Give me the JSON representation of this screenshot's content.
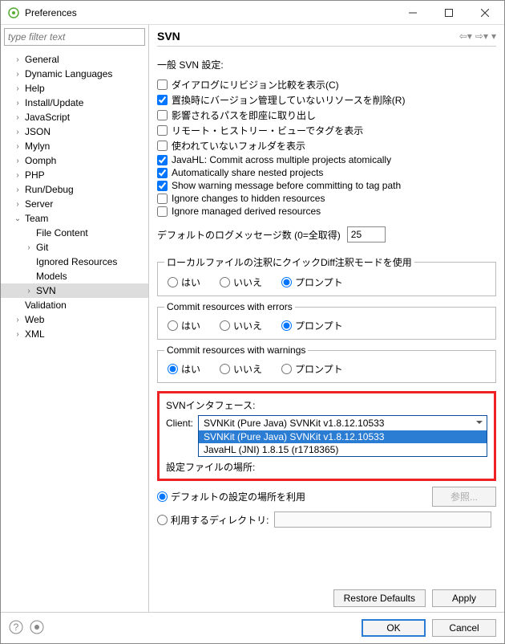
{
  "titlebar": {
    "title": "Preferences"
  },
  "filter": {
    "placeholder": "type filter text"
  },
  "tree": {
    "items": [
      {
        "label": "General",
        "indent": 1,
        "twisty": ">"
      },
      {
        "label": "Dynamic Languages",
        "indent": 1,
        "twisty": ">"
      },
      {
        "label": "Help",
        "indent": 1,
        "twisty": ">"
      },
      {
        "label": "Install/Update",
        "indent": 1,
        "twisty": ">"
      },
      {
        "label": "JavaScript",
        "indent": 1,
        "twisty": ">"
      },
      {
        "label": "JSON",
        "indent": 1,
        "twisty": ">"
      },
      {
        "label": "Mylyn",
        "indent": 1,
        "twisty": ">"
      },
      {
        "label": "Oomph",
        "indent": 1,
        "twisty": ">"
      },
      {
        "label": "PHP",
        "indent": 1,
        "twisty": ">"
      },
      {
        "label": "Run/Debug",
        "indent": 1,
        "twisty": ">"
      },
      {
        "label": "Server",
        "indent": 1,
        "twisty": ">"
      },
      {
        "label": "Team",
        "indent": 1,
        "twisty": "v"
      },
      {
        "label": "File Content",
        "indent": 2,
        "twisty": ""
      },
      {
        "label": "Git",
        "indent": 2,
        "twisty": ">"
      },
      {
        "label": "Ignored Resources",
        "indent": 2,
        "twisty": ""
      },
      {
        "label": "Models",
        "indent": 2,
        "twisty": ""
      },
      {
        "label": "SVN",
        "indent": 2,
        "twisty": ">",
        "selected": true
      },
      {
        "label": "Validation",
        "indent": 1,
        "twisty": ""
      },
      {
        "label": "Web",
        "indent": 1,
        "twisty": ">"
      },
      {
        "label": "XML",
        "indent": 1,
        "twisty": ">"
      }
    ]
  },
  "page": {
    "title": "SVN",
    "generalHeading": "一般 SVN 設定:",
    "checks": [
      {
        "label": "ダイアログにリビジョン比較を表示(C)",
        "checked": false
      },
      {
        "label": "置換時にバージョン管理していないリソースを削除(R)",
        "checked": true
      },
      {
        "label": "影響されるパスを即座に取り出し",
        "checked": false
      },
      {
        "label": "リモート・ヒストリー・ビューでタグを表示",
        "checked": false
      },
      {
        "label": "使われていないフォルダを表示",
        "checked": false
      },
      {
        "label": "JavaHL: Commit across multiple projects atomically",
        "checked": true
      },
      {
        "label": "Automatically share nested projects",
        "checked": true
      },
      {
        "label": "Show warning message before committing to tag path",
        "checked": true
      },
      {
        "label": "Ignore changes to hidden resources",
        "checked": false
      },
      {
        "label": "Ignore managed derived resources",
        "checked": false
      }
    ],
    "logCountLabel": "デフォルトのログメッセージ数 (0=全取得)",
    "logCountValue": "25",
    "groups": [
      {
        "legend": "ローカルファイルの注釈にクイックDiff注釈モードを使用",
        "radios": [
          {
            "label": "はい",
            "checked": false
          },
          {
            "label": "いいえ",
            "checked": false
          },
          {
            "label": "プロンプト",
            "checked": true
          }
        ]
      },
      {
        "legend": "Commit resources with errors",
        "radios": [
          {
            "label": "はい",
            "checked": false
          },
          {
            "label": "いいえ",
            "checked": false
          },
          {
            "label": "プロンプト",
            "checked": true
          }
        ]
      },
      {
        "legend": "Commit resources with warnings",
        "radios": [
          {
            "label": "はい",
            "checked": true
          },
          {
            "label": "いいえ",
            "checked": false
          },
          {
            "label": "プロンプト",
            "checked": false
          }
        ]
      }
    ],
    "interfaceHeading": "SVNインタフェース:",
    "clientLabel": "Client:",
    "clientSelected": "SVNKit (Pure Java) SVNKit v1.8.12.10533",
    "clientOptions": [
      "SVNKit (Pure Java) SVNKit v1.8.12.10533",
      "JavaHL (JNI) 1.8.15 (r1718365)"
    ],
    "configLocHeading": "設定ファイルの場所:",
    "configLoc": [
      {
        "label": "デフォルトの設定の場所を利用",
        "checked": true
      },
      {
        "label": "利用するディレクトリ:",
        "checked": false
      }
    ],
    "browseBtn": "参照...",
    "restoreBtn": "Restore Defaults",
    "applyBtn": "Apply"
  },
  "footer": {
    "ok": "OK",
    "cancel": "Cancel"
  }
}
